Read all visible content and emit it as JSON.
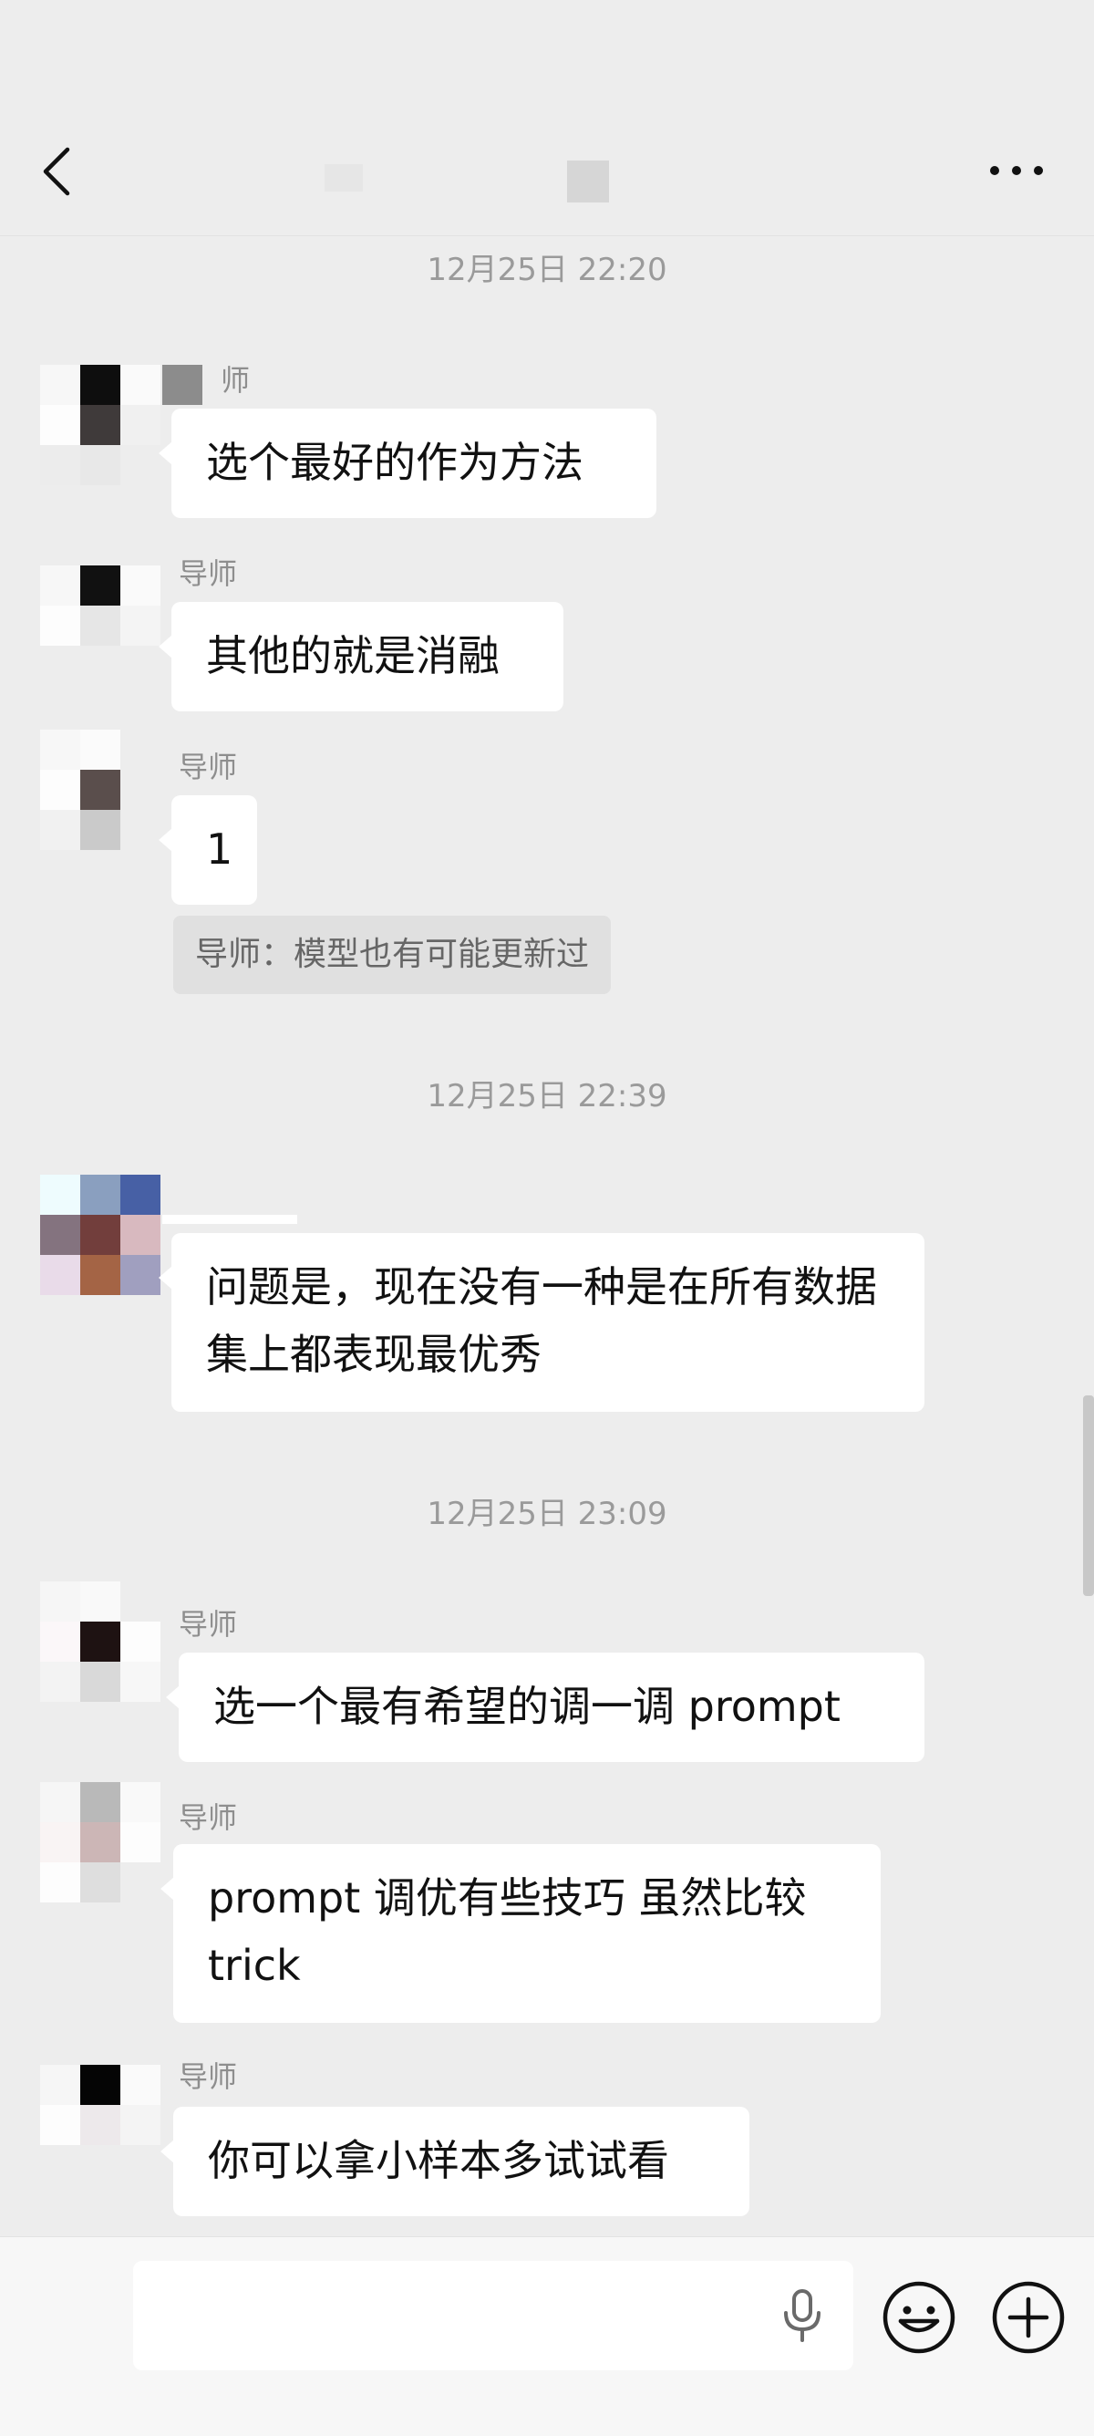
{
  "header": {
    "back_icon": "chevron-left-icon",
    "more_icon": "more-dots-icon"
  },
  "messages": {
    "ts1": "12月25日 22:20",
    "m1_sender": "师",
    "m1_text": "选个最好的作为方法",
    "m2_sender": "导师",
    "m2_text": "其他的就是消融",
    "m3_sender": "导师",
    "m3_text": "1",
    "m3_quote": "导师：模型也有可能更新过",
    "ts2": "12月25日 22:39",
    "m4_text": "问题是，现在没有一种是在所有数据集上都表现最优秀",
    "ts3": "12月25日 23:09",
    "m5_sender": "导师",
    "m5_text": "选一个最有希望的调一调 prompt",
    "m6_sender": "导师",
    "m6_text": "prompt 调优有些技巧 虽然比较trick",
    "m7_sender": "导师",
    "m7_text": "你可以拿小样本多试试看"
  },
  "input": {
    "value": "",
    "mic_icon": "microphone-icon",
    "emoji_icon": "emoji-icon",
    "plus_icon": "plus-circle-icon"
  },
  "colors": {
    "background": "#ededed",
    "bubble": "#ffffff",
    "timestamp": "#9a9a9a",
    "sender": "#8e8e8e"
  }
}
